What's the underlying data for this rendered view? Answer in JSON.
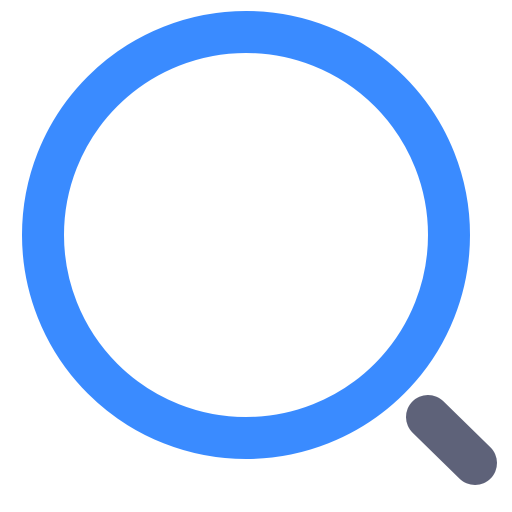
{
  "icon": {
    "name": "search-icon",
    "lens_color": "#3A8BFF",
    "handle_color": "#5E6279",
    "background": "#FFFFFF"
  }
}
